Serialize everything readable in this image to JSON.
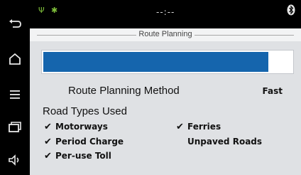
{
  "nav": {
    "items": [
      {
        "name": "back-icon"
      },
      {
        "name": "home-icon"
      },
      {
        "name": "menu-icon"
      },
      {
        "name": "window-icon"
      },
      {
        "name": "volume-icon"
      }
    ]
  },
  "status": {
    "time": "--:--",
    "icons": [
      "usb-icon",
      "android-debug-icon",
      "bluetooth-icon"
    ]
  },
  "page": {
    "title": "Route Planning"
  },
  "progress": {
    "fraction": 0.905,
    "color": "#1565ad"
  },
  "route_method": {
    "label": "Route Planning Method",
    "value": "Fast"
  },
  "road_types": {
    "heading": "Road Types Used",
    "items": [
      {
        "label": "Motorways",
        "checked": true
      },
      {
        "label": "Ferries",
        "checked": true
      },
      {
        "label": "Period Charge",
        "checked": true
      },
      {
        "label": "Unpaved Roads",
        "checked": false
      },
      {
        "label": "Per-use Toll",
        "checked": true
      }
    ],
    "check_glyph": "✔"
  }
}
